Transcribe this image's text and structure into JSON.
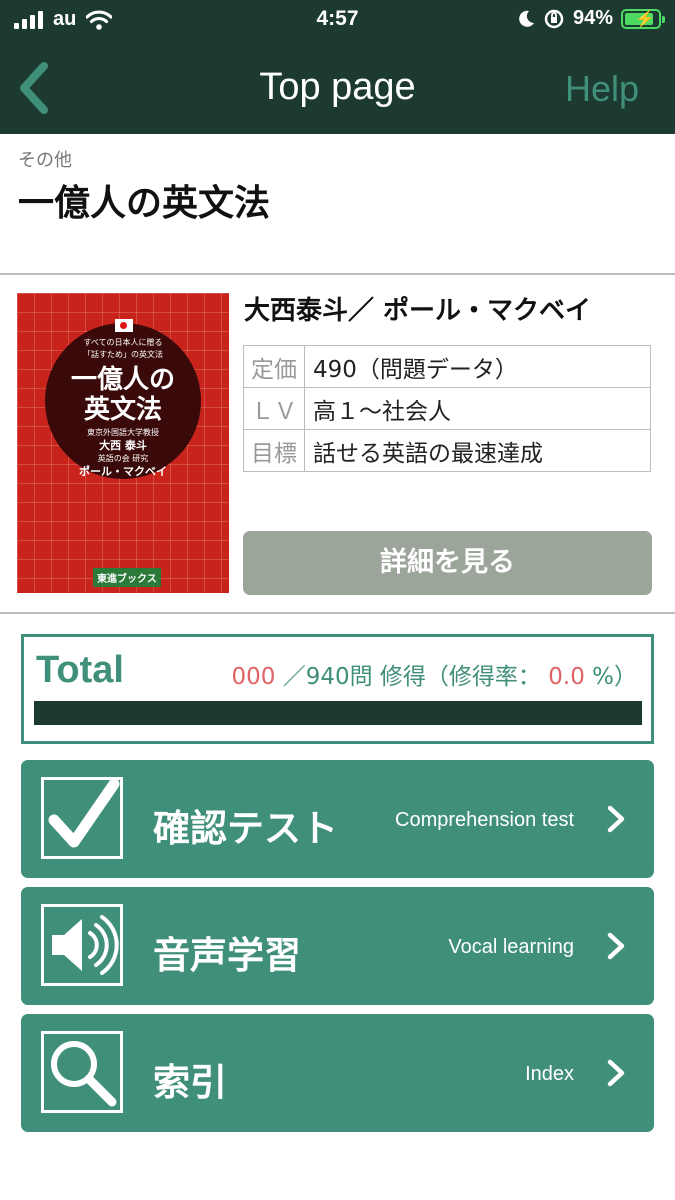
{
  "status_bar": {
    "carrier": "au",
    "time": "4:57",
    "battery": "94%"
  },
  "nav": {
    "title": "Top page",
    "help": "Help"
  },
  "book": {
    "category": "その他",
    "title": "一億人の英文法",
    "authors": "大西泰斗／ ポール・マクベイ",
    "cover": {
      "subtitle_line1": "すべての日本人に贈る",
      "subtitle_line2": "「話すため」の英文法",
      "title_line1": "一億人の",
      "title_line2": "英文法",
      "author1_role": "東京外国語大学教授",
      "author1": "大西 泰斗",
      "author2_role": "英語の会 研究",
      "author2": "ポール・マクベイ",
      "publisher": "東進ブックス"
    },
    "info": [
      {
        "key": "定価",
        "value": "490（問題データ）"
      },
      {
        "key": "ＬＶ",
        "value": "高１～社会人"
      },
      {
        "key": "目標",
        "value": "話せる英語の最速達成"
      }
    ],
    "detail_button": "詳細を見る"
  },
  "total": {
    "label": "Total",
    "mastered": "000",
    "of_text": "／940問 修得（修得率：",
    "rate": "0.0",
    "rate_suffix": "%）",
    "progress_fraction": 0.0
  },
  "menu": [
    {
      "label": "確認テスト",
      "sub": "Comprehension test",
      "icon": "checkbox-icon"
    },
    {
      "label": "音声学習",
      "sub": "Vocal learning",
      "icon": "speaker-icon"
    },
    {
      "label": "索引",
      "sub": "Index",
      "icon": "magnifier-icon"
    }
  ],
  "colors": {
    "nav_bg": "#1d3a31",
    "accent": "#3f8f7a",
    "highlight": "#e06366",
    "detail_btn": "#9ca59a"
  }
}
